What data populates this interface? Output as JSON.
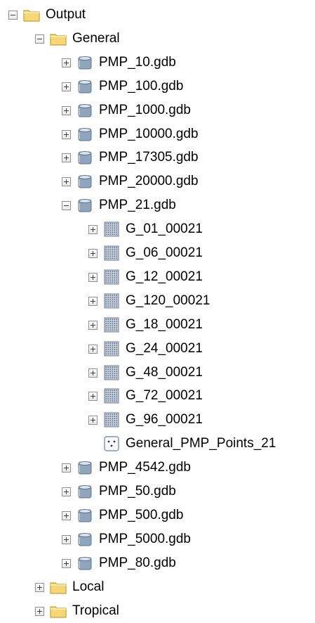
{
  "tree": [
    {
      "label": "Output",
      "icon": "folder-icon",
      "depth": 0,
      "state": "expanded"
    },
    {
      "label": "General",
      "icon": "folder-icon",
      "depth": 1,
      "state": "expanded"
    },
    {
      "label": "PMP_10.gdb",
      "icon": "geodatabase-icon",
      "depth": 2,
      "state": "collapsed"
    },
    {
      "label": "PMP_100.gdb",
      "icon": "geodatabase-icon",
      "depth": 2,
      "state": "collapsed"
    },
    {
      "label": "PMP_1000.gdb",
      "icon": "geodatabase-icon",
      "depth": 2,
      "state": "collapsed"
    },
    {
      "label": "PMP_10000.gdb",
      "icon": "geodatabase-icon",
      "depth": 2,
      "state": "collapsed"
    },
    {
      "label": "PMP_17305.gdb",
      "icon": "geodatabase-icon",
      "depth": 2,
      "state": "collapsed"
    },
    {
      "label": "PMP_20000.gdb",
      "icon": "geodatabase-icon",
      "depth": 2,
      "state": "collapsed"
    },
    {
      "label": "PMP_21.gdb",
      "icon": "geodatabase-icon",
      "depth": 2,
      "state": "expanded"
    },
    {
      "label": "G_01_00021",
      "icon": "raster-icon",
      "depth": 3,
      "state": "collapsed"
    },
    {
      "label": "G_06_00021",
      "icon": "raster-icon",
      "depth": 3,
      "state": "collapsed"
    },
    {
      "label": "G_12_00021",
      "icon": "raster-icon",
      "depth": 3,
      "state": "collapsed"
    },
    {
      "label": "G_120_00021",
      "icon": "raster-icon",
      "depth": 3,
      "state": "collapsed"
    },
    {
      "label": "G_18_00021",
      "icon": "raster-icon",
      "depth": 3,
      "state": "collapsed"
    },
    {
      "label": "G_24_00021",
      "icon": "raster-icon",
      "depth": 3,
      "state": "collapsed"
    },
    {
      "label": "G_48_00021",
      "icon": "raster-icon",
      "depth": 3,
      "state": "collapsed"
    },
    {
      "label": "G_72_00021",
      "icon": "raster-icon",
      "depth": 3,
      "state": "collapsed"
    },
    {
      "label": "G_96_00021",
      "icon": "raster-icon",
      "depth": 3,
      "state": "collapsed"
    },
    {
      "label": "General_PMP_Points_21",
      "icon": "point-feature-class-icon",
      "depth": 3,
      "state": "none"
    },
    {
      "label": "PMP_4542.gdb",
      "icon": "geodatabase-icon",
      "depth": 2,
      "state": "collapsed"
    },
    {
      "label": "PMP_50.gdb",
      "icon": "geodatabase-icon",
      "depth": 2,
      "state": "collapsed"
    },
    {
      "label": "PMP_500.gdb",
      "icon": "geodatabase-icon",
      "depth": 2,
      "state": "collapsed"
    },
    {
      "label": "PMP_5000.gdb",
      "icon": "geodatabase-icon",
      "depth": 2,
      "state": "collapsed"
    },
    {
      "label": "PMP_80.gdb",
      "icon": "geodatabase-icon",
      "depth": 2,
      "state": "collapsed"
    },
    {
      "label": "Local",
      "icon": "folder-icon",
      "depth": 1,
      "state": "collapsed"
    },
    {
      "label": "Tropical",
      "icon": "folder-icon",
      "depth": 1,
      "state": "collapsed"
    }
  ],
  "colors": {
    "folder_fill": "#f7d774",
    "folder_stroke": "#c9a22e",
    "gdb_fill": "#8ea5bd",
    "gdb_stroke": "#5f7489",
    "raster_fill": "#c9d2df",
    "raster_dots": "#5f7186"
  }
}
